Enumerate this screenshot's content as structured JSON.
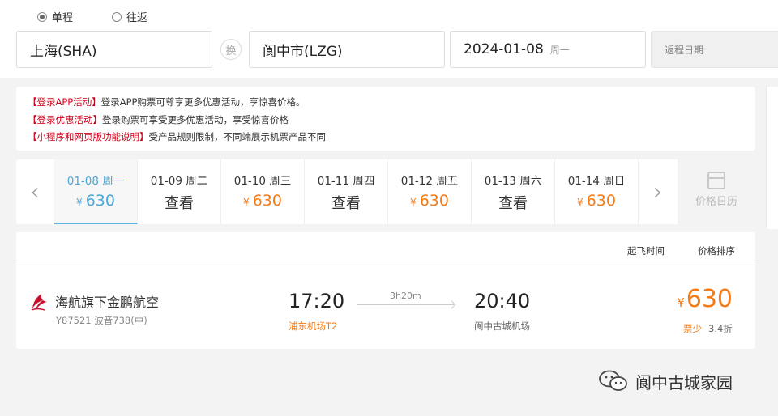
{
  "trip_type": {
    "one_way": "单程",
    "round_trip": "往返"
  },
  "search": {
    "from": "上海(SHA)",
    "swap": "换",
    "to": "阆中市(LZG)",
    "depart_date": "2024-01-08",
    "depart_weekday": "周一",
    "return_placeholder": "返程日期"
  },
  "notices": [
    {
      "tag": "【登录APP活动】",
      "text": "登录APP购票可尊享更多优惠活动，享惊喜价格。"
    },
    {
      "tag": "【登录优惠活动】",
      "text": "登录购票可享受更多优惠活动，享受惊喜价格"
    },
    {
      "tag": "【小程序和网页版功能说明】",
      "text": "受产品规则限制，不同端展示机票产品不同"
    }
  ],
  "date_strip": {
    "days": [
      {
        "date": "01-08 周一",
        "price": "630",
        "currency": "¥",
        "selected": true
      },
      {
        "date": "01-09 周二",
        "price": "查看",
        "currency": "",
        "selected": false
      },
      {
        "date": "01-10 周三",
        "price": "630",
        "currency": "¥",
        "selected": false
      },
      {
        "date": "01-11 周四",
        "price": "查看",
        "currency": "",
        "selected": false
      },
      {
        "date": "01-12 周五",
        "price": "630",
        "currency": "¥",
        "selected": false
      },
      {
        "date": "01-13 周六",
        "price": "查看",
        "currency": "",
        "selected": false
      },
      {
        "date": "01-14 周日",
        "price": "630",
        "currency": "¥",
        "selected": false
      }
    ],
    "calendar_label": "价格日历"
  },
  "sort": {
    "departure_time": "起飞时间",
    "price_sort": "价格排序"
  },
  "flights": [
    {
      "airline": "海航旗下金鹏航空",
      "flight_info": "Y87521 波音738(中)",
      "dep_time": "17:20",
      "dep_airport": "浦东机场T2",
      "duration": "3h20m",
      "arr_time": "20:40",
      "arr_airport": "阆中古城机场",
      "currency": "¥",
      "price": "630",
      "seats": "票少",
      "discount": "3.4折"
    }
  ],
  "watermark": "阆中古城家园",
  "colors": {
    "accent_orange": "#f67b14",
    "selected_blue": "#4aa8d8",
    "notice_red": "#d0021b"
  }
}
